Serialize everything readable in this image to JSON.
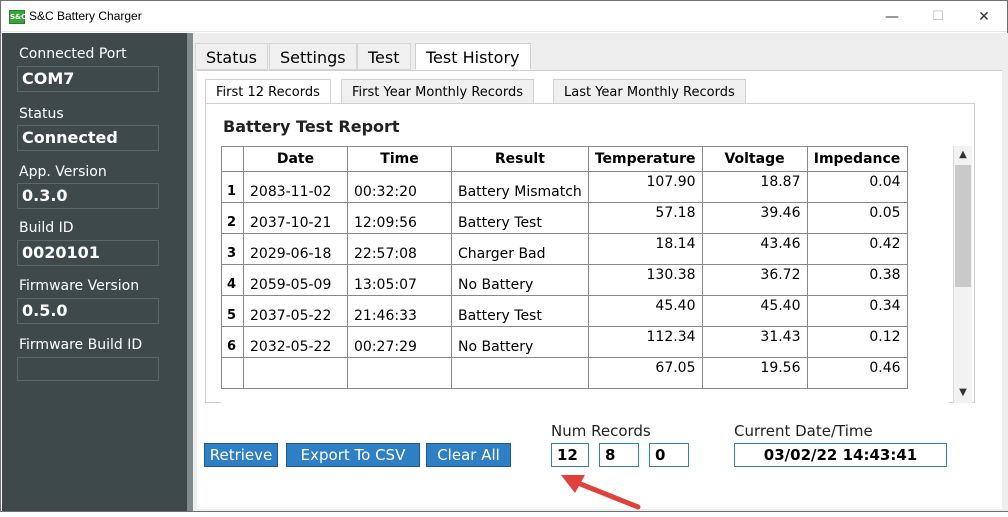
{
  "window": {
    "title": "S&C Battery Charger",
    "minimize_icon": "minimize-icon",
    "maximize_icon": "maximize-icon",
    "close_icon": "close-icon"
  },
  "sidebar": {
    "connected_port_label": "Connected Port",
    "connected_port_value": "COM7",
    "status_label": "Status",
    "status_value": "Connected",
    "app_version_label": "App. Version",
    "app_version_value": "0.3.0",
    "build_id_label": "Build ID",
    "build_id_value": "0020101",
    "firmware_version_label": "Firmware Version",
    "firmware_version_value": "0.5.0",
    "firmware_build_id_label": "Firmware Build ID",
    "firmware_build_id_value": ""
  },
  "tabs": [
    "Status",
    "Settings",
    "Test",
    "Test History"
  ],
  "subtabs": [
    "First 12 Records",
    "First Year Monthly Records",
    "Last Year Monthly Records"
  ],
  "report": {
    "title": "Battery Test Report",
    "columns": [
      "Date",
      "Time",
      "Result",
      "Temperature",
      "Voltage",
      "Impedance"
    ],
    "rows": [
      {
        "n": "1",
        "date": "2083-11-02",
        "time": "00:32:20",
        "result": "Battery Mismatch",
        "temp": "107.90",
        "volt": "18.87",
        "imp": "0.04"
      },
      {
        "n": "2",
        "date": "2037-10-21",
        "time": "12:09:56",
        "result": "Battery Test",
        "temp": "57.18",
        "volt": "39.46",
        "imp": "0.05"
      },
      {
        "n": "3",
        "date": "2029-06-18",
        "time": "22:57:08",
        "result": "Charger Bad",
        "temp": "18.14",
        "volt": "43.46",
        "imp": "0.42"
      },
      {
        "n": "4",
        "date": "2059-05-09",
        "time": "13:05:07",
        "result": "No Battery",
        "temp": "130.38",
        "volt": "36.72",
        "imp": "0.38"
      },
      {
        "n": "5",
        "date": "2037-05-22",
        "time": "21:46:33",
        "result": "Battery Test",
        "temp": "45.40",
        "volt": "45.40",
        "imp": "0.34"
      },
      {
        "n": "6",
        "date": "2032-05-22",
        "time": "00:27:29",
        "result": "No Battery",
        "temp": "112.34",
        "volt": "31.43",
        "imp": "0.12"
      },
      {
        "n": "",
        "date": "",
        "time": "",
        "result": "",
        "temp": "67.05",
        "volt": "19.56",
        "imp": "0.46"
      }
    ]
  },
  "buttons": {
    "retrieve": "Retrieve",
    "export_csv": "Export To CSV",
    "clear_all": "Clear All"
  },
  "num_records": {
    "label": "Num Records",
    "a": "12",
    "b": "8",
    "c": "0"
  },
  "current_datetime": {
    "label": "Current Date/Time",
    "value": "03/02/22 14:43:41"
  },
  "colors": {
    "sidebar": "#3e4a4a",
    "button": "#2f7fc4",
    "arrow": "#e0413a"
  }
}
